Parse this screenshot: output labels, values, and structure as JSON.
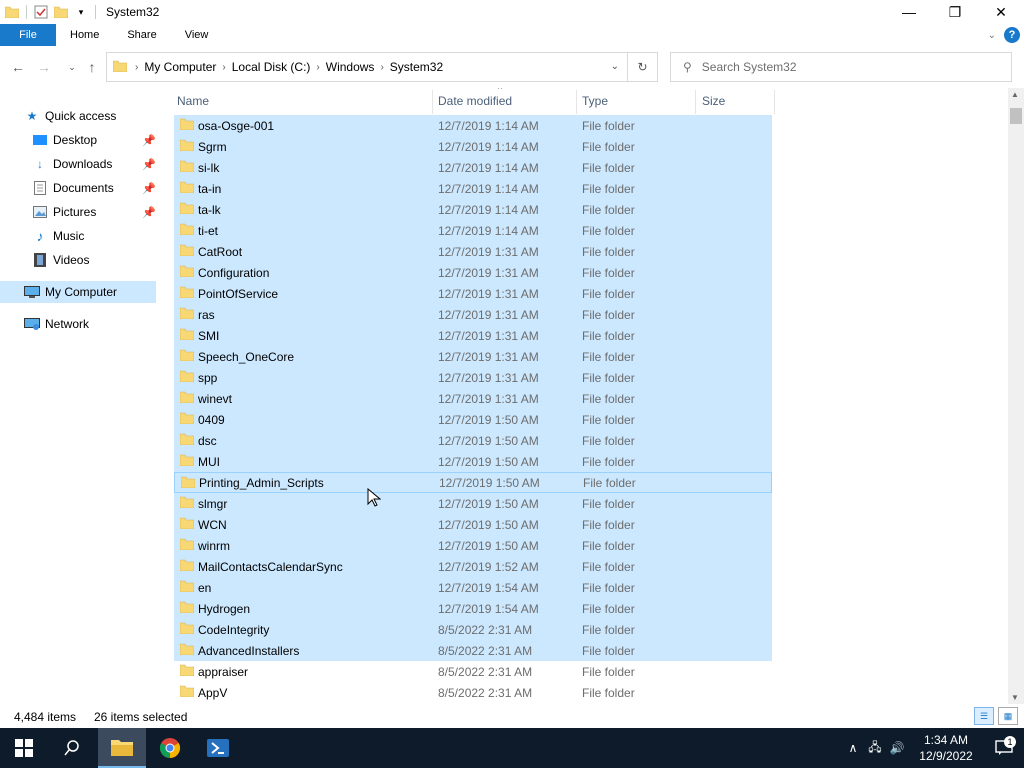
{
  "window": {
    "title": "System32",
    "controls": {
      "minimize": "—",
      "maximize": "❐",
      "close": "✕"
    }
  },
  "ribbon": {
    "tabs": [
      "File",
      "Home",
      "Share",
      "View"
    ],
    "help_label": "?"
  },
  "address": {
    "crumbs": [
      "My Computer",
      "Local Disk (C:)",
      "Windows",
      "System32"
    ]
  },
  "search": {
    "placeholder": "Search System32"
  },
  "navpane": {
    "items": [
      {
        "label": "Quick access",
        "icon": "star-icon"
      },
      {
        "label": "Desktop",
        "icon": "desktop-icon",
        "pinned": true
      },
      {
        "label": "Downloads",
        "icon": "download-icon",
        "pinned": true
      },
      {
        "label": "Documents",
        "icon": "document-icon",
        "pinned": true
      },
      {
        "label": "Pictures",
        "icon": "pictures-icon",
        "pinned": true
      },
      {
        "label": "Music",
        "icon": "music-icon"
      },
      {
        "label": "Videos",
        "icon": "videos-icon"
      },
      {
        "label": "My Computer",
        "icon": "computer-icon",
        "selected": true
      },
      {
        "label": "Network",
        "icon": "network-icon"
      }
    ]
  },
  "columns": [
    "Name",
    "Date modified",
    "Type",
    "Size"
  ],
  "files": [
    {
      "name": "osa-Osge-001",
      "date": "12/7/2019 1:14 AM",
      "type": "File folder",
      "selected": true
    },
    {
      "name": "Sgrm",
      "date": "12/7/2019 1:14 AM",
      "type": "File folder",
      "selected": true
    },
    {
      "name": "si-lk",
      "date": "12/7/2019 1:14 AM",
      "type": "File folder",
      "selected": true
    },
    {
      "name": "ta-in",
      "date": "12/7/2019 1:14 AM",
      "type": "File folder",
      "selected": true
    },
    {
      "name": "ta-lk",
      "date": "12/7/2019 1:14 AM",
      "type": "File folder",
      "selected": true
    },
    {
      "name": "ti-et",
      "date": "12/7/2019 1:14 AM",
      "type": "File folder",
      "selected": true
    },
    {
      "name": "CatRoot",
      "date": "12/7/2019 1:31 AM",
      "type": "File folder",
      "selected": true
    },
    {
      "name": "Configuration",
      "date": "12/7/2019 1:31 AM",
      "type": "File folder",
      "selected": true
    },
    {
      "name": "PointOfService",
      "date": "12/7/2019 1:31 AM",
      "type": "File folder",
      "selected": true
    },
    {
      "name": "ras",
      "date": "12/7/2019 1:31 AM",
      "type": "File folder",
      "selected": true
    },
    {
      "name": "SMI",
      "date": "12/7/2019 1:31 AM",
      "type": "File folder",
      "selected": true
    },
    {
      "name": "Speech_OneCore",
      "date": "12/7/2019 1:31 AM",
      "type": "File folder",
      "selected": true
    },
    {
      "name": "spp",
      "date": "12/7/2019 1:31 AM",
      "type": "File folder",
      "selected": true
    },
    {
      "name": "winevt",
      "date": "12/7/2019 1:31 AM",
      "type": "File folder",
      "selected": true
    },
    {
      "name": "0409",
      "date": "12/7/2019 1:50 AM",
      "type": "File folder",
      "selected": true
    },
    {
      "name": "dsc",
      "date": "12/7/2019 1:50 AM",
      "type": "File folder",
      "selected": true
    },
    {
      "name": "MUI",
      "date": "12/7/2019 1:50 AM",
      "type": "File folder",
      "selected": true
    },
    {
      "name": "Printing_Admin_Scripts",
      "date": "12/7/2019 1:50 AM",
      "type": "File folder",
      "selected": true,
      "focused": true
    },
    {
      "name": "slmgr",
      "date": "12/7/2019 1:50 AM",
      "type": "File folder",
      "selected": true
    },
    {
      "name": "WCN",
      "date": "12/7/2019 1:50 AM",
      "type": "File folder",
      "selected": true
    },
    {
      "name": "winrm",
      "date": "12/7/2019 1:50 AM",
      "type": "File folder",
      "selected": true
    },
    {
      "name": "MailContactsCalendarSync",
      "date": "12/7/2019 1:52 AM",
      "type": "File folder",
      "selected": true
    },
    {
      "name": "en",
      "date": "12/7/2019 1:54 AM",
      "type": "File folder",
      "selected": true
    },
    {
      "name": "Hydrogen",
      "date": "12/7/2019 1:54 AM",
      "type": "File folder",
      "selected": true
    },
    {
      "name": "CodeIntegrity",
      "date": "8/5/2022 2:31 AM",
      "type": "File folder",
      "selected": true
    },
    {
      "name": "AdvancedInstallers",
      "date": "8/5/2022 2:31 AM",
      "type": "File folder",
      "selected": true
    },
    {
      "name": "appraiser",
      "date": "8/5/2022 2:31 AM",
      "type": "File folder",
      "selected": false
    },
    {
      "name": "AppV",
      "date": "8/5/2022 2:31 AM",
      "type": "File folder",
      "selected": false
    }
  ],
  "status": {
    "item_count": "4,484 items",
    "selected_count": "26 items selected"
  },
  "clock": {
    "time": "1:34 AM",
    "date": "12/9/2022"
  },
  "notifications": {
    "count": "1"
  },
  "colors": {
    "accent": "#1979ca",
    "selection": "#cce8ff",
    "folder": "#f8d775",
    "taskbar": "#0d1b2a"
  }
}
